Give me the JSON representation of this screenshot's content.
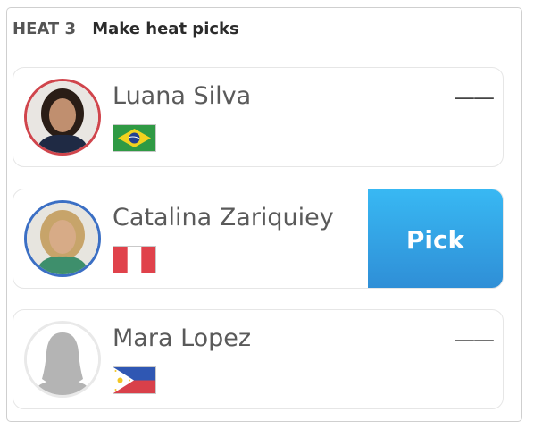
{
  "header": {
    "heat_label": "HEAT 3",
    "title": "Make heat picks"
  },
  "surfers": [
    {
      "name": "Luana Silva",
      "country": "Brazil",
      "status": "——",
      "ring_color": "#d0454c",
      "avatar": "photo"
    },
    {
      "name": "Catalina Zariquiey",
      "country": "Peru",
      "action": "Pick",
      "ring_color": "#3b6fc4",
      "avatar": "photo"
    },
    {
      "name": "Mara Lopez",
      "country": "Philippines",
      "status": "——",
      "ring_color": "#e9e9e9",
      "avatar": "placeholder-silhouette"
    }
  ],
  "colors": {
    "pick_button": "#33a4e6"
  }
}
